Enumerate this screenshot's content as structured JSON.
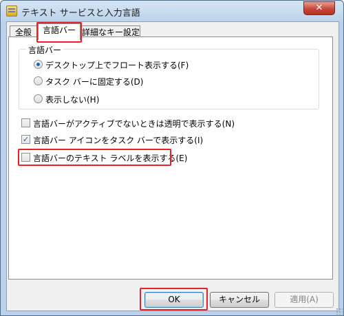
{
  "window": {
    "title": "テキスト サービスと入力言語",
    "close_glyph": "✕"
  },
  "tabs": [
    {
      "label": "全般",
      "active": false
    },
    {
      "label": "言語バー",
      "active": true
    },
    {
      "label": "詳細なキー設定",
      "active": false
    }
  ],
  "group": {
    "title": "言語バー",
    "options": [
      {
        "label": "デスクトップ上でフロート表示する(F)",
        "checked": true
      },
      {
        "label": "タスク バーに固定する(D)",
        "checked": false
      },
      {
        "label": "表示しない(H)",
        "checked": false
      }
    ]
  },
  "checkboxes": [
    {
      "label": "言語バーがアクティブでないときは透明で表示する(N)",
      "checked": false
    },
    {
      "label": "言語バー アイコンをタスク バーで表示する(I)",
      "checked": true
    },
    {
      "label": "言語バーのテキスト ラベルを表示する(E)",
      "checked": false
    }
  ],
  "buttons": {
    "ok": "OK",
    "cancel": "キャンセル",
    "apply": "適用(A)"
  },
  "icons": {
    "app": "keyboard-settings-icon",
    "close": "close-icon",
    "check_glyph": "✓"
  },
  "colors": {
    "highlight": "#e8202a",
    "radio_dot": "#1c62c4"
  }
}
